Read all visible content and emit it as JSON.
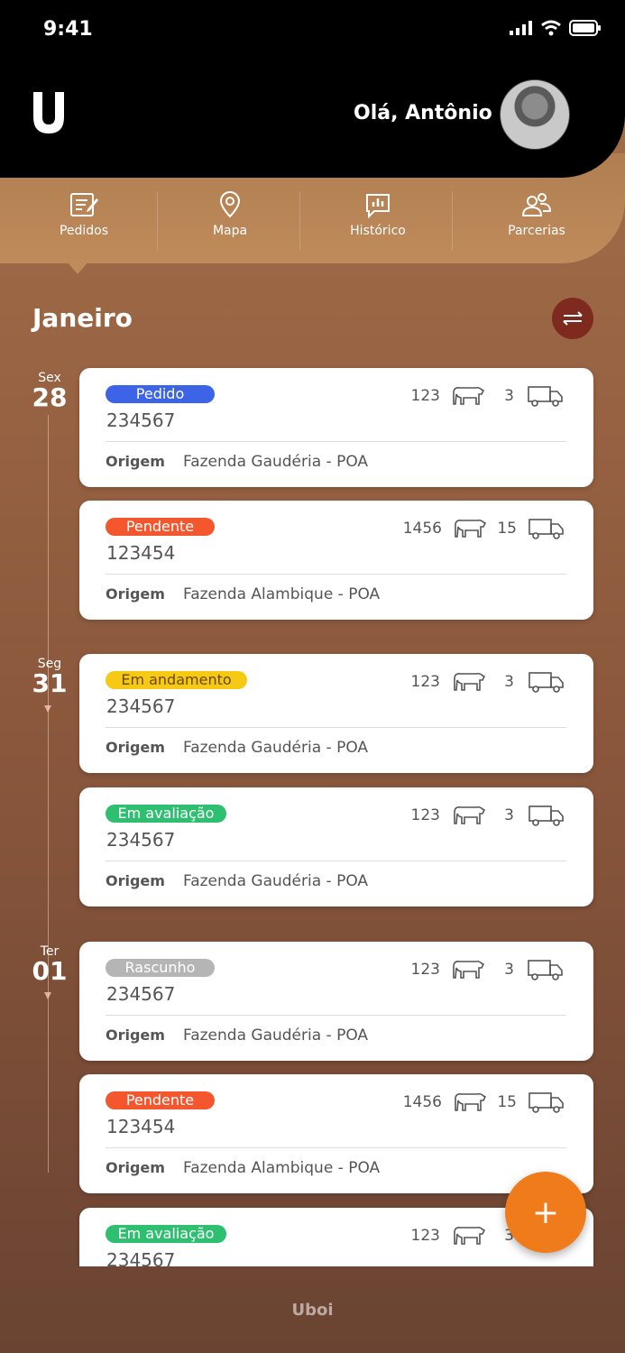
{
  "status_bar": {
    "time": "9:41"
  },
  "header": {
    "logo_letter": "U",
    "greeting": "Olá, Antônio"
  },
  "tabs": [
    {
      "label": "Pedidos",
      "icon": "orders-icon"
    },
    {
      "label": "Mapa",
      "icon": "map-pin-icon"
    },
    {
      "label": "Histórico",
      "icon": "history-chart-icon"
    },
    {
      "label": "Parcerias",
      "icon": "partners-icon"
    }
  ],
  "month": "Janeiro",
  "days": [
    {
      "dow": "Sex",
      "num": "28"
    },
    {
      "dow": "Seg",
      "num": "31"
    },
    {
      "dow": "Ter",
      "num": "01"
    }
  ],
  "origin_label": "Origem",
  "colors": {
    "pedido": "#3d63e6",
    "pendente": "#f4572e",
    "em_andamento": "#f6c915",
    "em_avaliacao": "#2fbf71",
    "rascunho": "#b5b5b5",
    "fab": "#f07b1b"
  },
  "orders": [
    {
      "status": "Pedido",
      "id": "234567",
      "animals": "123",
      "trucks": "3",
      "origin": "Fazenda Gaudéria - POA"
    },
    {
      "status": "Pendente",
      "id": "123454",
      "animals": "1456",
      "trucks": "15",
      "origin": "Fazenda Alambique - POA"
    },
    {
      "status": "Em andamento",
      "id": "234567",
      "animals": "123",
      "trucks": "3",
      "origin": "Fazenda Gaudéria - POA"
    },
    {
      "status": "Em avaliação",
      "id": "234567",
      "animals": "123",
      "trucks": "3",
      "origin": "Fazenda Gaudéria - POA"
    },
    {
      "status": "Rascunho",
      "id": "234567",
      "animals": "123",
      "trucks": "3",
      "origin": "Fazenda Gaudéria - POA"
    },
    {
      "status": "Pendente",
      "id": "123454",
      "animals": "1456",
      "trucks": "15",
      "origin": "Fazenda Alambique - POA"
    },
    {
      "status": "Em avaliação",
      "id": "234567",
      "animals": "123",
      "trucks": "3",
      "origin": ""
    }
  ],
  "fab_label": "+",
  "footer_brand": "Uboi"
}
